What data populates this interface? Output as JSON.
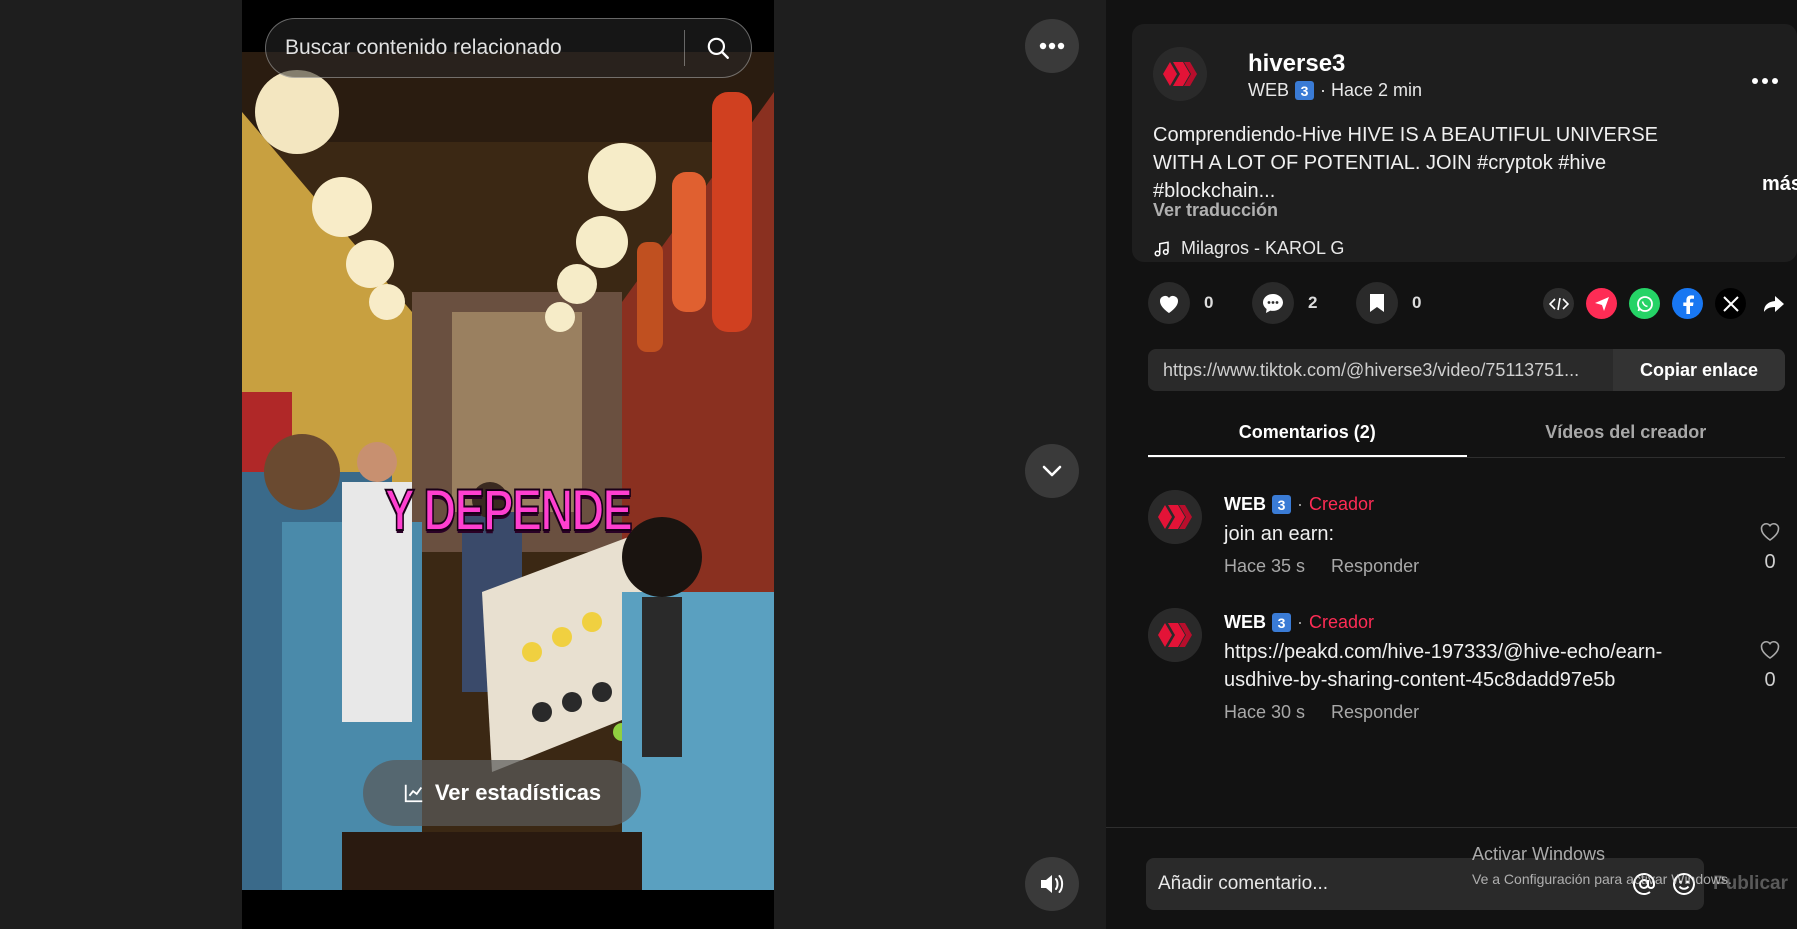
{
  "search": {
    "placeholder": "Buscar contenido relacionado"
  },
  "video": {
    "overlay_text": "Y DEPENDE",
    "stats_button": "Ver estadísticas",
    "controls": {
      "more_icon": "ellipsis-icon",
      "next_icon": "chevron-down-icon",
      "volume_icon": "volume-icon"
    }
  },
  "post": {
    "author": "hiverse3",
    "nickname": "WEB",
    "badge": "3",
    "time": "· Hace 2 min",
    "description": "Comprendiendo-Hive HIVE IS A BEAUTIFUL UNIVERSE WITH A LOT OF POTENTIAL. JOIN #cryptok #hive #blockchain...",
    "more": "más",
    "translate": "Ver traducción",
    "music": "Milagros - KAROL G"
  },
  "actions": {
    "likes": "0",
    "comments": "2",
    "saves": "0"
  },
  "share": {
    "icons": [
      "embed-icon",
      "send-icon",
      "whatsapp-icon",
      "facebook-icon",
      "x-icon",
      "share-arrow-icon"
    ]
  },
  "link": {
    "url": "https://www.tiktok.com/@hiverse3/video/75113751...",
    "copy_label": "Copiar enlace"
  },
  "tabs": [
    "Comentarios (2)",
    "Vídeos del creador"
  ],
  "comments": [
    {
      "user": "WEB",
      "badge": "3",
      "sep": "·",
      "role": "Creador",
      "text": "join an earn:",
      "time": "Hace 35 s",
      "reply": "Responder",
      "likes": "0"
    },
    {
      "user": "WEB",
      "badge": "3",
      "sep": "·",
      "role": "Creador",
      "text": "https://peakd.com/hive-197333/@hive-echo/earn-usdhive-by-sharing-content-45c8dadd97e5b",
      "time": "Hace 30 s",
      "reply": "Responder",
      "likes": "0"
    }
  ],
  "composer": {
    "placeholder": "Añadir comentario...",
    "publish": "Publicar"
  },
  "watermark": {
    "title": "Activar Windows",
    "subtitle": "Ve a Configuración para activar Windows."
  },
  "colors": {
    "accent": "#fe2c55",
    "panel_bg": "#121212",
    "card_bg": "#1e1e1e",
    "badge_blue": "#3a7bd5"
  }
}
